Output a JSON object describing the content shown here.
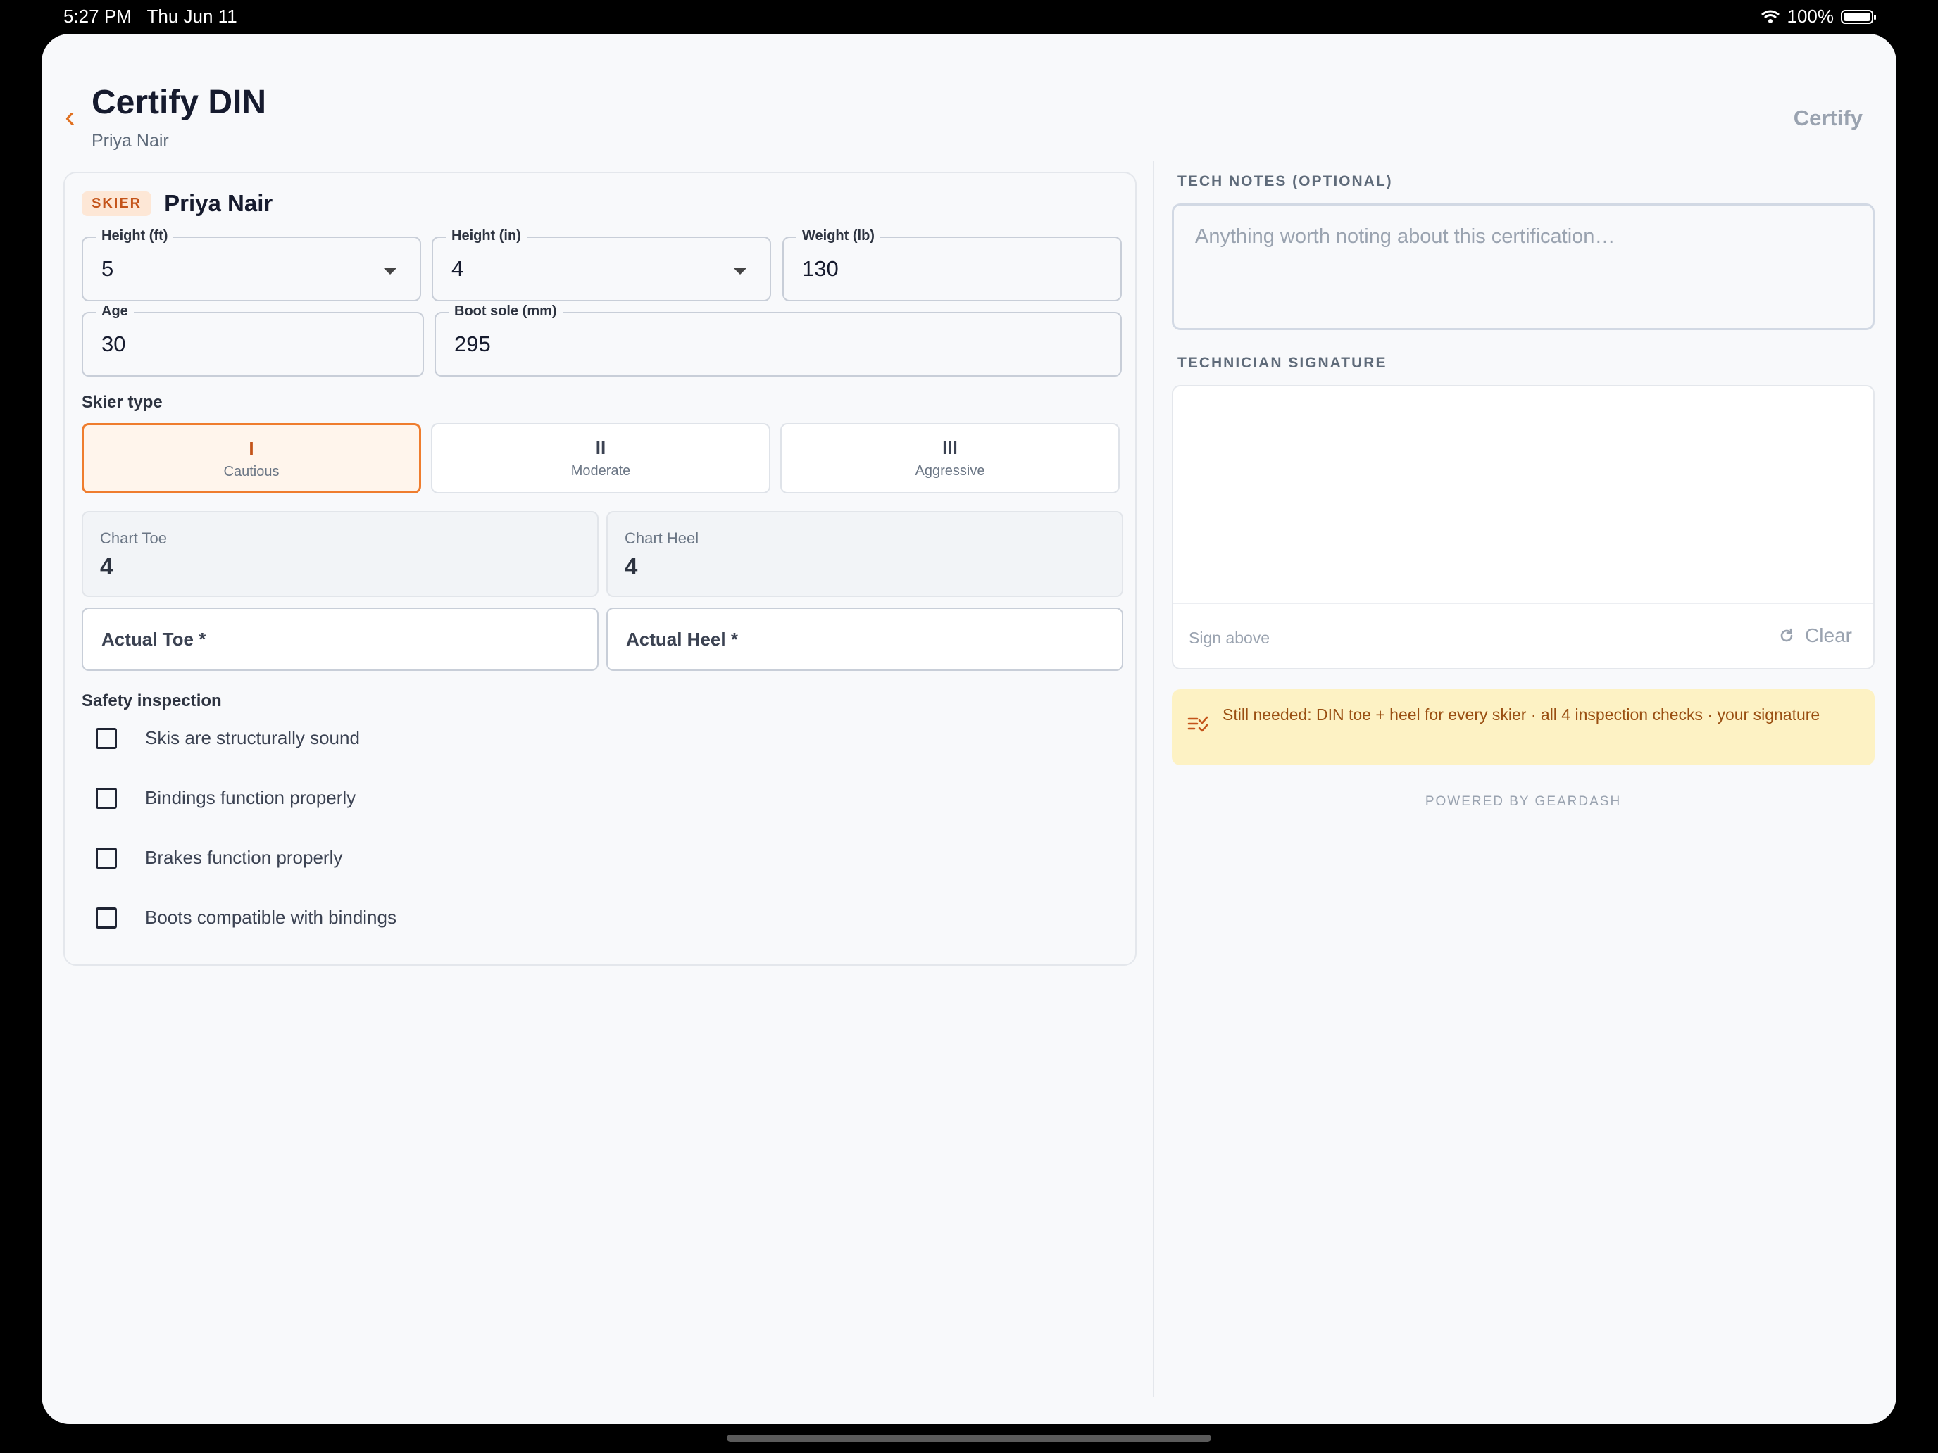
{
  "status_bar": {
    "time": "5:27 PM",
    "date": "Thu Jun 11",
    "battery": "100%"
  },
  "header": {
    "title": "Certify DIN",
    "subtitle": "Priya Nair",
    "certify_label": "Certify"
  },
  "skier": {
    "badge": "SKIER",
    "name": "Priya Nair",
    "fields": {
      "height_ft": {
        "label": "Height (ft)",
        "value": "5"
      },
      "height_in": {
        "label": "Height (in)",
        "value": "4"
      },
      "weight": {
        "label": "Weight (lb)",
        "value": "130"
      },
      "age": {
        "label": "Age",
        "value": "30"
      },
      "boot_sole": {
        "label": "Boot sole (mm)",
        "value": "295"
      }
    },
    "skier_type_label": "Skier type",
    "skier_types": [
      {
        "num": "I",
        "label": "Cautious",
        "selected": true
      },
      {
        "num": "II",
        "label": "Moderate",
        "selected": false
      },
      {
        "num": "III",
        "label": "Aggressive",
        "selected": false
      }
    ],
    "chart_toe": {
      "label": "Chart Toe",
      "value": "4"
    },
    "chart_heel": {
      "label": "Chart Heel",
      "value": "4"
    },
    "actual_toe_placeholder": "Actual Toe *",
    "actual_heel_placeholder": "Actual Heel *",
    "safety_label": "Safety inspection",
    "checks": [
      {
        "label": "Skis are structurally sound",
        "checked": false
      },
      {
        "label": "Bindings function properly",
        "checked": false
      },
      {
        "label": "Brakes function properly",
        "checked": false
      },
      {
        "label": "Boots compatible with bindings",
        "checked": false
      }
    ]
  },
  "right": {
    "notes_label": "TECH NOTES (OPTIONAL)",
    "notes_placeholder": "Anything worth noting about this certification…",
    "signature_label": "TECHNICIAN SIGNATURE",
    "sign_above": "Sign above",
    "clear_label": "Clear",
    "alert_text": "Still needed: DIN toe + heel for every skier · all 4 inspection checks · your signature",
    "powered_by": "POWERED BY GEARDASH"
  },
  "colors": {
    "accent": "#ef7d2e",
    "alert_bg": "#fdf2c4",
    "alert_text": "#9a4f12"
  },
  "icons": [
    "back-chevron-icon",
    "dropdown-caret-icon",
    "refresh-icon",
    "checklist-icon",
    "wifi-icon",
    "battery-icon"
  ]
}
